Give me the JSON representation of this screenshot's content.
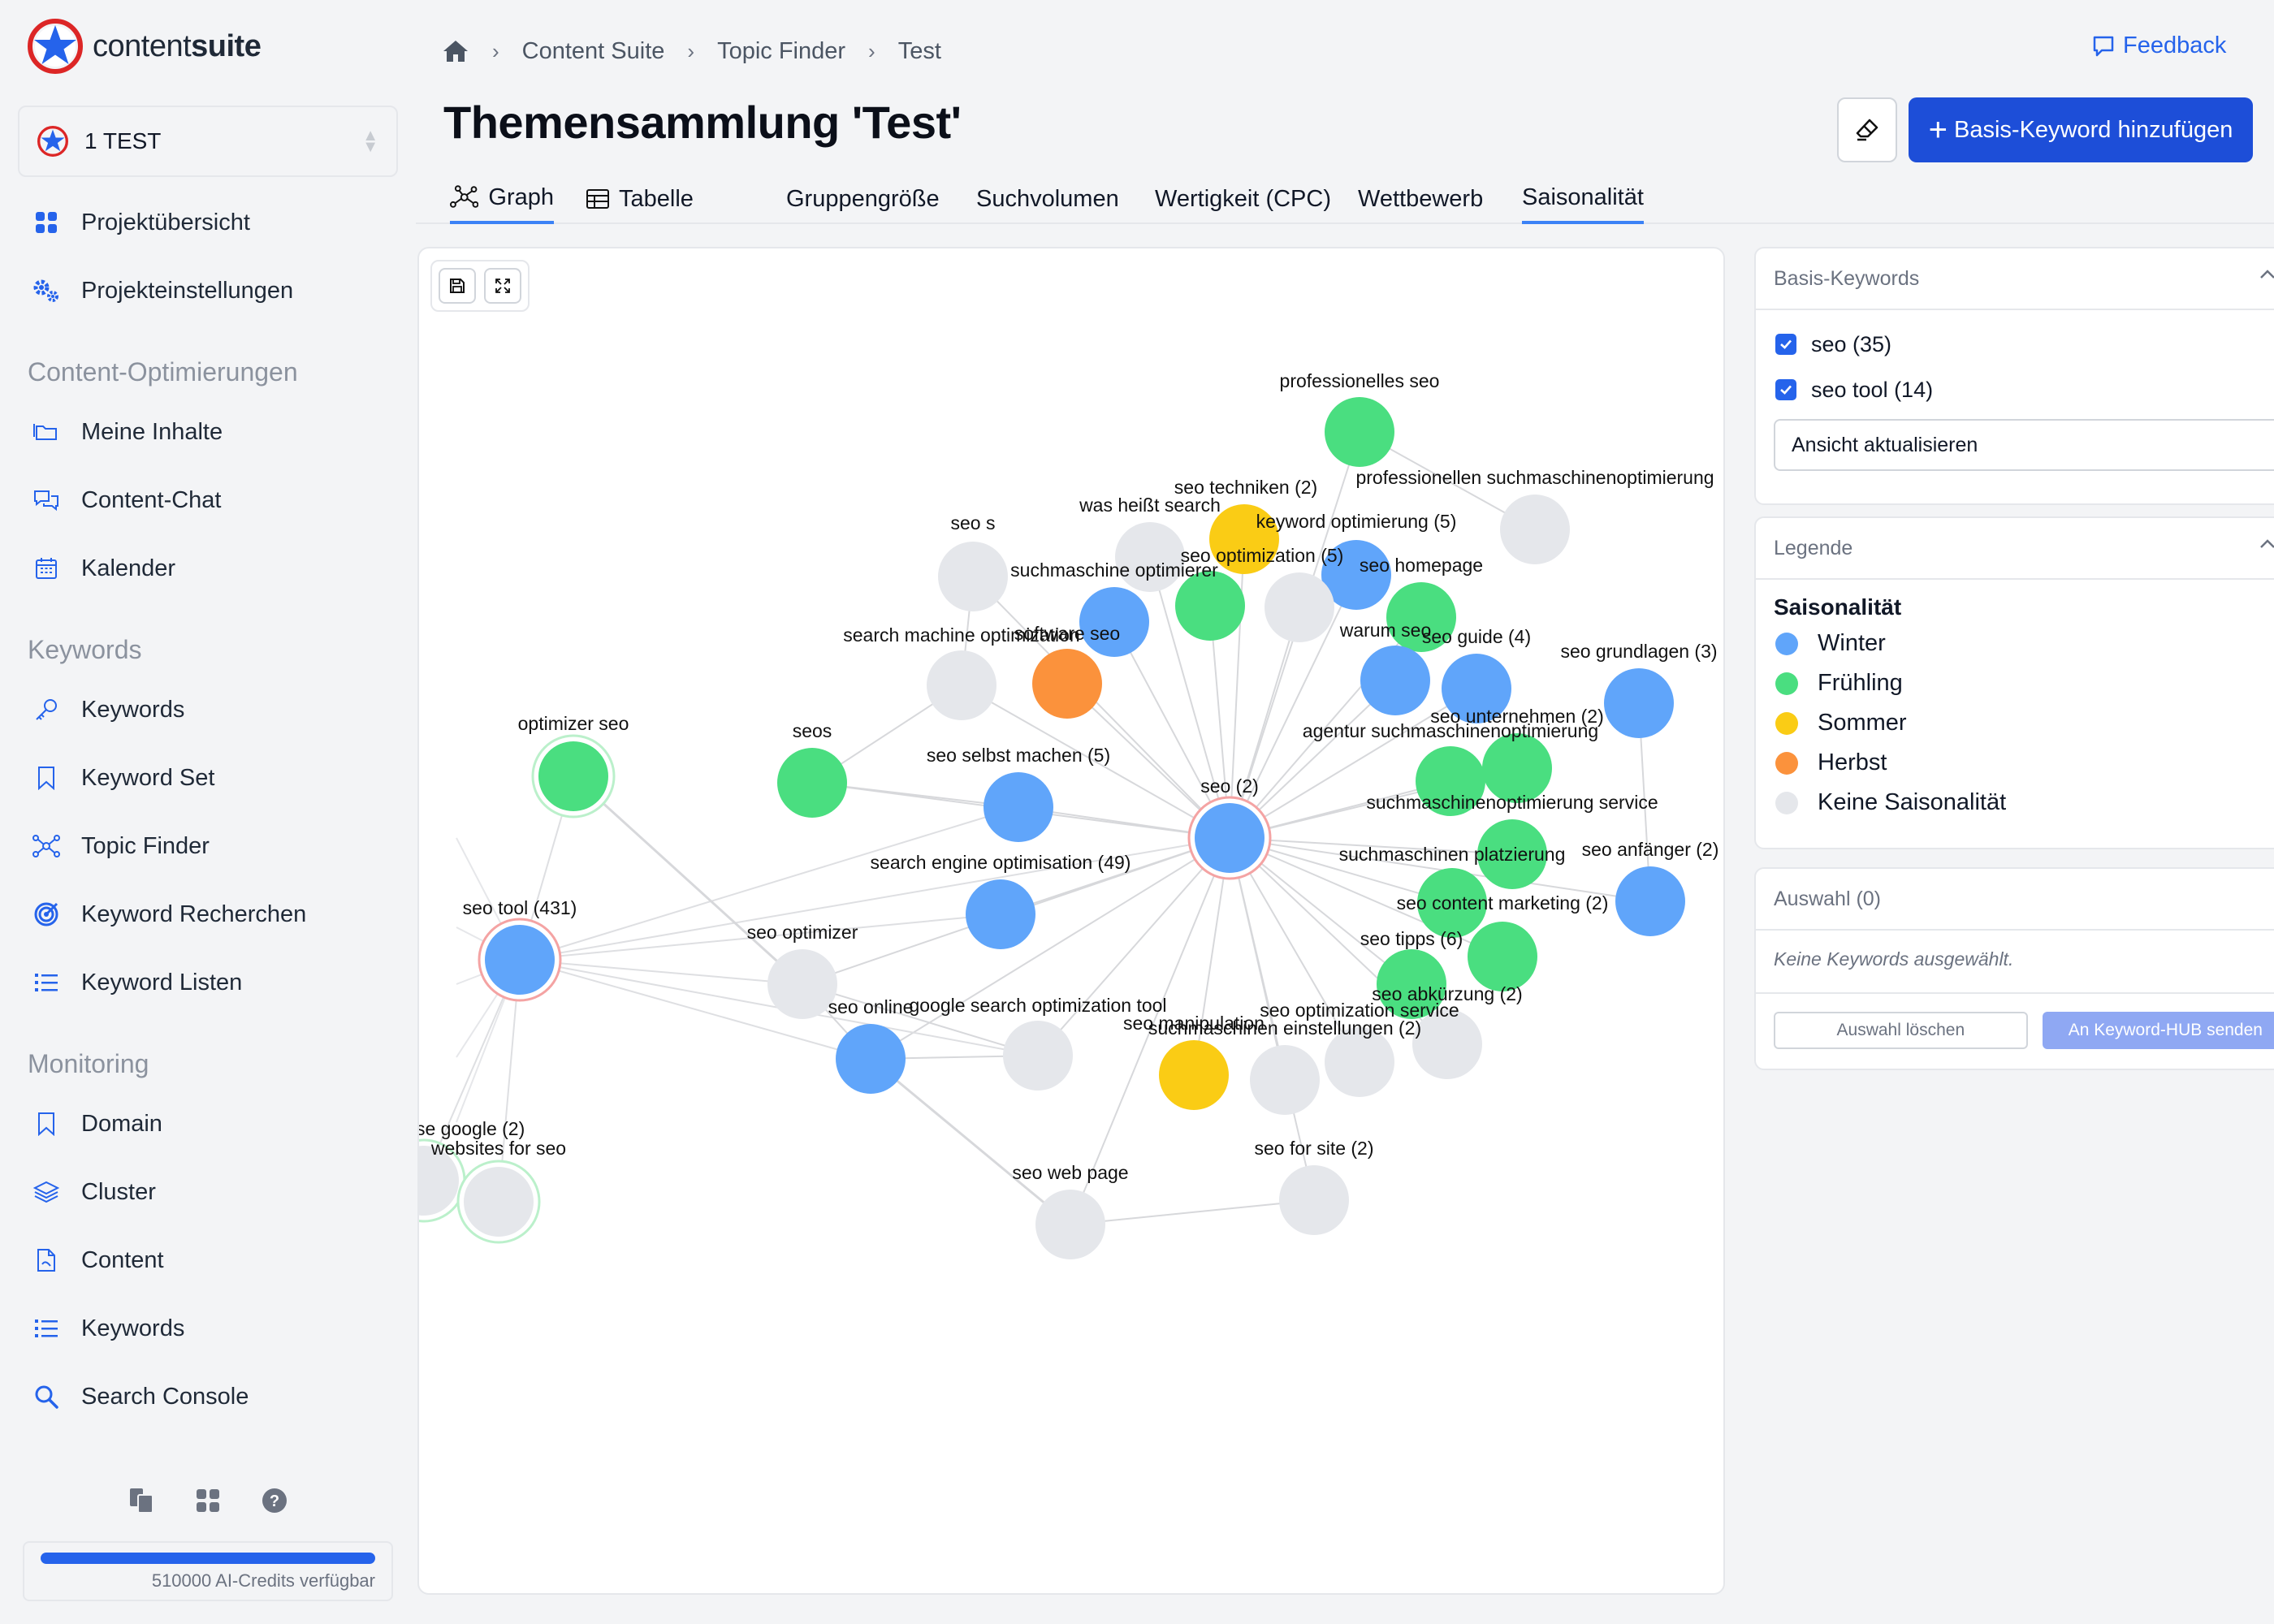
{
  "app": {
    "logo_text_light": "content",
    "logo_text_bold": "suite"
  },
  "project": {
    "name": "1 TEST"
  },
  "sidebar": {
    "top_items": [
      {
        "label": "Projektübersicht",
        "icon": "grid-icon"
      },
      {
        "label": "Projekteinstellungen",
        "icon": "gears-icon"
      }
    ],
    "sections": [
      {
        "title": "Content-Optimierungen",
        "items": [
          {
            "label": "Meine Inhalte",
            "icon": "folder-icon"
          },
          {
            "label": "Content-Chat",
            "icon": "chat-icon"
          },
          {
            "label": "Kalender",
            "icon": "calendar-icon"
          }
        ]
      },
      {
        "title": "Keywords",
        "items": [
          {
            "label": "Keywords",
            "icon": "key-icon"
          },
          {
            "label": "Keyword Set",
            "icon": "bookmark-icon"
          },
          {
            "label": "Topic Finder",
            "icon": "network-icon"
          },
          {
            "label": "Keyword Recherchen",
            "icon": "target-icon"
          },
          {
            "label": "Keyword Listen",
            "icon": "list-icon"
          }
        ]
      },
      {
        "title": "Monitoring",
        "items": [
          {
            "label": "Domain",
            "icon": "bookmark-icon"
          },
          {
            "label": "Cluster",
            "icon": "layers-icon"
          },
          {
            "label": "Content",
            "icon": "document-icon"
          },
          {
            "label": "Keywords",
            "icon": "list-icon"
          },
          {
            "label": "Search Console",
            "icon": "search-icon"
          }
        ]
      }
    ],
    "credits_text": "510000 AI-Credits verfügbar"
  },
  "breadcrumb": [
    "Content Suite",
    "Topic Finder",
    "Test"
  ],
  "feedback_label": "Feedback",
  "page_title": "Themensammlung 'Test'",
  "add_button_label": "Basis-Keyword hinzufügen",
  "tabs": {
    "view": [
      {
        "label": "Graph",
        "active": true
      },
      {
        "label": "Tabelle",
        "active": false
      }
    ],
    "metric": [
      {
        "label": "Gruppengröße",
        "active": false
      },
      {
        "label": "Suchvolumen",
        "active": false
      },
      {
        "label": "Wertigkeit (CPC)",
        "active": false
      },
      {
        "label": "Wettbewerb",
        "active": false
      },
      {
        "label": "Saisonalität",
        "active": true
      }
    ]
  },
  "colors": {
    "winter": "#60a5fa",
    "spring": "#4ade80",
    "summer": "#facc15",
    "autumn": "#fb923c",
    "none": "#e5e7eb",
    "accent": "#1d4ed8"
  },
  "graph": {
    "nodes": [
      {
        "id": "prof",
        "label": "professionelles seo",
        "season": "spring"
      },
      {
        "id": "profsm",
        "label": "professionellen suchmaschinenoptimierung",
        "season": "none"
      },
      {
        "id": "techniken",
        "label": "seo techniken (2)",
        "season": "summer"
      },
      {
        "id": "washeisst",
        "label": "was heißt search",
        "season": "none"
      },
      {
        "id": "kwopt",
        "label": "keyword optimierung (5)",
        "season": "winter"
      },
      {
        "id": "seos",
        "label": "seo s",
        "season": "none"
      },
      {
        "id": "suchmaschine",
        "label": "suchmaschine optimierer",
        "season": "winter"
      },
      {
        "id": "seooptimization",
        "label": "seo optimization (5)",
        "season": "spring"
      },
      {
        "id": "optbetween",
        "label": "",
        "season": "none"
      },
      {
        "id": "homepage",
        "label": "seo homepage",
        "season": "spring"
      },
      {
        "id": "smo",
        "label": "search machine optimization",
        "season": "none"
      },
      {
        "id": "software",
        "label": "software seo",
        "season": "autumn"
      },
      {
        "id": "warum",
        "label": "warum seo",
        "season": "winter"
      },
      {
        "id": "guide",
        "label": "seo guide (4)",
        "season": "winter"
      },
      {
        "id": "grundlagen",
        "label": "seo grundlagen (3)",
        "season": "winter"
      },
      {
        "id": "optimizerseo",
        "label": "optimizer seo",
        "season": "spring"
      },
      {
        "id": "seosplain",
        "label": "seos",
        "season": "spring"
      },
      {
        "id": "selbst",
        "label": "seo selbst machen (5)",
        "season": "winter"
      },
      {
        "id": "agentur",
        "label": "agentur suchmaschinenoptimierung",
        "season": "spring"
      },
      {
        "id": "unternehmen",
        "label": "seo unternehmen (2)",
        "season": "spring"
      },
      {
        "id": "seo2",
        "label": "seo (2)",
        "season": "winter"
      },
      {
        "id": "service",
        "label": "suchmaschinenoptimierung service",
        "season": "spring"
      },
      {
        "id": "seo_eng",
        "label": "search engine optimisation (49)",
        "season": "winter"
      },
      {
        "id": "platzierung",
        "label": "suchmaschinen platzierung",
        "season": "spring"
      },
      {
        "id": "anfaenger",
        "label": "seo anfänger (2)",
        "season": "winter"
      },
      {
        "id": "contentmarketing",
        "label": "seo content marketing (2)",
        "season": "spring"
      },
      {
        "id": "seotool",
        "label": "seo tool (431)",
        "season": "winter"
      },
      {
        "id": "optimizer",
        "label": "seo optimizer",
        "season": "none"
      },
      {
        "id": "tipps",
        "label": "seo tipps (6)",
        "season": "spring"
      },
      {
        "id": "abkuerzung",
        "label": "seo abkürzung (2)",
        "season": "none"
      },
      {
        "id": "online",
        "label": "seo online",
        "season": "winter"
      },
      {
        "id": "gsot",
        "label": "google search optimization tool",
        "season": "none"
      },
      {
        "id": "manipulation",
        "label": "seo manipulation",
        "season": "summer"
      },
      {
        "id": "einstellungen",
        "label": "suchmaschinen einstellungen (2)",
        "season": "none"
      },
      {
        "id": "optservice",
        "label": "seo optimization service",
        "season": "none"
      },
      {
        "id": "segoogle",
        "label": "se google (2)",
        "season": "none"
      },
      {
        "id": "websites",
        "label": "websites for seo",
        "season": "none"
      },
      {
        "id": "webpage",
        "label": "seo web page",
        "season": "none"
      },
      {
        "id": "forsite",
        "label": "seo for site (2)",
        "season": "none"
      }
    ]
  },
  "basis_keywords": {
    "title": "Basis-Keywords",
    "items": [
      {
        "label": "seo (35)",
        "checked": true
      },
      {
        "label": "seo tool (14)",
        "checked": true
      }
    ],
    "update_label": "Ansicht aktualisieren"
  },
  "legend": {
    "title": "Legende",
    "subtitle": "Saisonalität",
    "items": [
      {
        "label": "Winter",
        "color": "#60a5fa"
      },
      {
        "label": "Frühling",
        "color": "#4ade80"
      },
      {
        "label": "Sommer",
        "color": "#facc15"
      },
      {
        "label": "Herbst",
        "color": "#fb923c"
      },
      {
        "label": "Keine Saisonalität",
        "color": "#e5e7eb"
      }
    ]
  },
  "selection": {
    "title": "Auswahl (0)",
    "empty_text": "Keine Keywords ausgewählt.",
    "clear_label": "Auswahl löschen",
    "send_label": "An Keyword-HUB senden"
  }
}
